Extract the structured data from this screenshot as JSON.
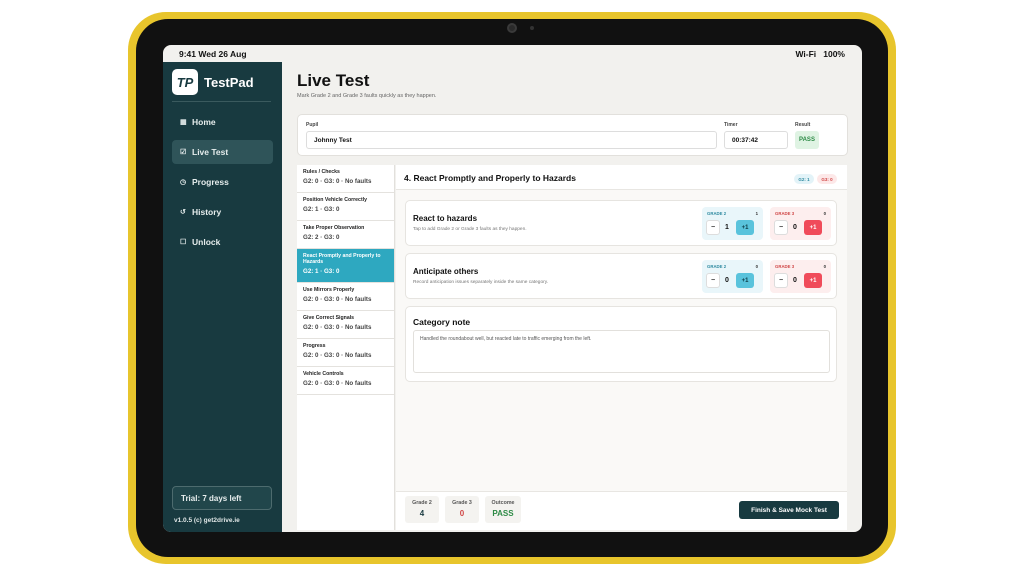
{
  "status": {
    "time_date": "9:41  Wed 26 Aug",
    "wifi": "Wi-Fi",
    "battery": "100%"
  },
  "app": {
    "logo_mark": "TP",
    "name": "TestPad"
  },
  "nav": [
    {
      "icon": "▦",
      "label": "Home"
    },
    {
      "icon": "☑",
      "label": "Live Test"
    },
    {
      "icon": "◷",
      "label": "Progress"
    },
    {
      "icon": "↺",
      "label": "History"
    },
    {
      "icon": "☐",
      "label": "Unlock"
    }
  ],
  "trial": "Trial: 7 days left",
  "version": "v1.0.5  (c) get2drive.ie",
  "page": {
    "title": "Live Test",
    "subtitle": "Mark Grade 2 and Grade 3 faults quickly as they happen."
  },
  "pupil": {
    "label": "Pupil",
    "value": "Johnny Test"
  },
  "timer": {
    "label": "Timer",
    "value": "00:37:42"
  },
  "result": {
    "label": "Result",
    "value": "PASS"
  },
  "categories": [
    {
      "title": "Rules / Checks",
      "summary": "G2: 0 · G3: 0 · No faults"
    },
    {
      "title": "Position Vehicle Correctly",
      "summary": "G2: 1 · G3: 0"
    },
    {
      "title": "Take Proper Observation",
      "summary": "G2: 2 · G3: 0"
    },
    {
      "title": "React Promptly and Properly to Hazards",
      "summary": "G2: 1 · G3: 0"
    },
    {
      "title": "Use Mirrors Properly",
      "summary": "G2: 0 · G3: 0 · No faults"
    },
    {
      "title": "Give Correct Signals",
      "summary": "G2: 0 · G3: 0 · No faults"
    },
    {
      "title": "Progress",
      "summary": "G2: 0 · G3: 0 · No faults"
    },
    {
      "title": "Vehicle Controls",
      "summary": "G2: 0 · G3: 0 · No faults"
    }
  ],
  "detail": {
    "title": "4. React Promptly and Properly to Hazards",
    "chip_g2": "G2: 1",
    "chip_g3": "G3: 0",
    "faults": [
      {
        "title": "React to hazards",
        "desc": "Tap to add Grade 2 or Grade 3 faults as they happen.",
        "g2": {
          "label": "GRADE 2",
          "count": "1",
          "minus": "−",
          "value": "1",
          "plus": "+1"
        },
        "g3": {
          "label": "GRADE 3",
          "count": "0",
          "minus": "−",
          "value": "0",
          "plus": "+1"
        }
      },
      {
        "title": "Anticipate others",
        "desc": "Record anticipation issues separately inside the same category.",
        "g2": {
          "label": "GRADE 2",
          "count": "0",
          "minus": "−",
          "value": "0",
          "plus": "+1"
        },
        "g3": {
          "label": "GRADE 3",
          "count": "0",
          "minus": "−",
          "value": "0",
          "plus": "+1"
        }
      }
    ],
    "note": {
      "title": "Category note",
      "text": "Handled the roundabout well, but reacted late to traffic emerging from the left."
    }
  },
  "summary": {
    "grade2": {
      "label": "Grade 2",
      "value": "4"
    },
    "grade3": {
      "label": "Grade 3",
      "value": "0"
    },
    "outcome": {
      "label": "Outcome",
      "value": "PASS"
    },
    "finish": "Finish & Save Mock Test"
  },
  "colors": {
    "sidebar": "#183a40",
    "accent": "#2ea8c0",
    "pass": "#2c8a45",
    "fail": "#f04b5a",
    "device": "#e8c52c"
  }
}
